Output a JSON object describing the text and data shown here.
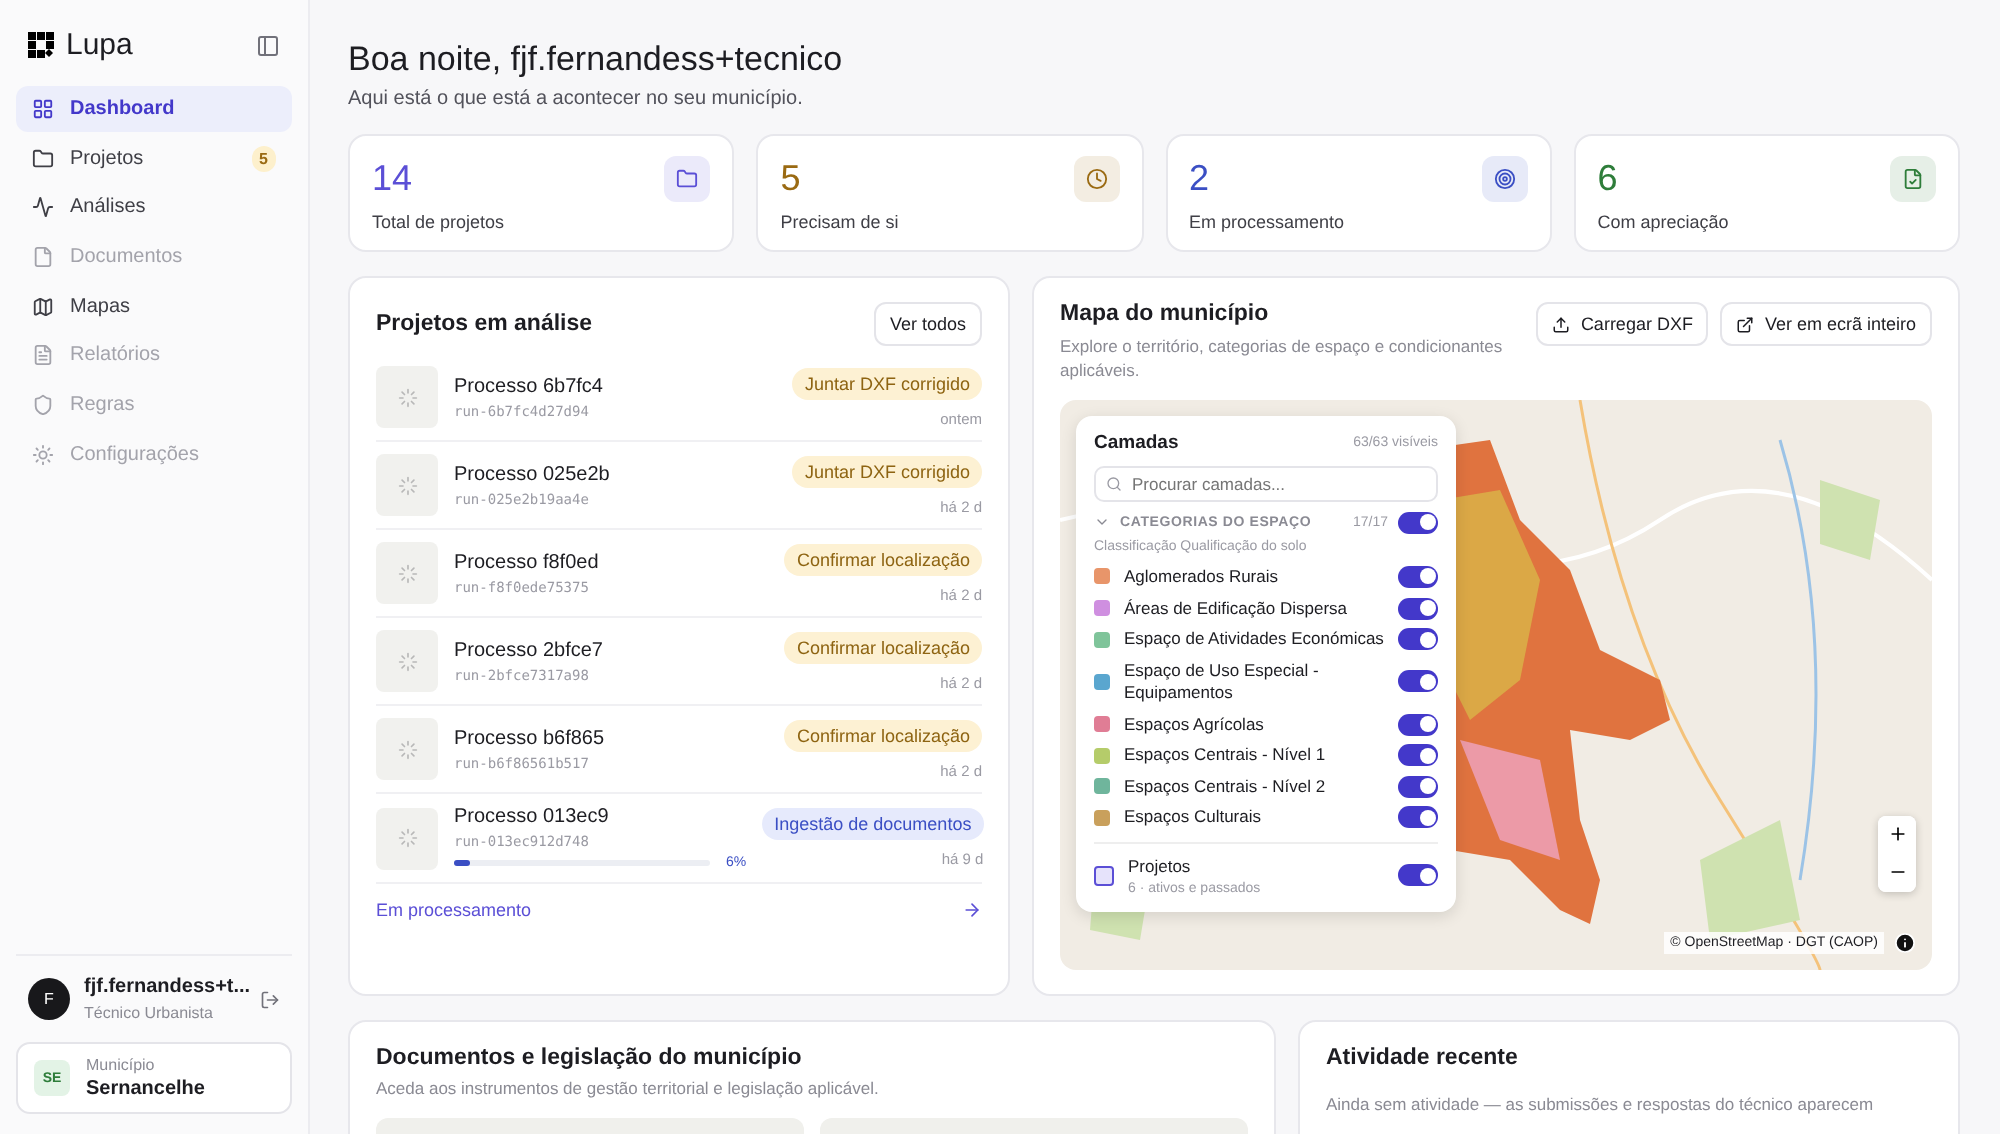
{
  "sidebar": {
    "brand": "Lupa",
    "items": [
      {
        "label": "Dashboard",
        "selected": true,
        "disabled": false
      },
      {
        "label": "Projetos",
        "selected": false,
        "disabled": false,
        "badge": "5"
      },
      {
        "label": "Análises",
        "selected": false,
        "disabled": false
      },
      {
        "label": "Documentos",
        "selected": false,
        "disabled": true
      },
      {
        "label": "Mapas",
        "selected": false,
        "disabled": false
      },
      {
        "label": "Relatórios",
        "selected": false,
        "disabled": true
      },
      {
        "label": "Regras",
        "selected": false,
        "disabled": true
      },
      {
        "label": "Configurações",
        "selected": false,
        "disabled": true
      }
    ],
    "user": {
      "initial": "F",
      "name": "fjf.fernandess+t...",
      "role": "Técnico Urbanista"
    },
    "municipality": {
      "code": "SE",
      "label": "Município",
      "name": "Sernancelhe"
    }
  },
  "header": {
    "title": "Boa noite, fjf.fernandess+tecnico",
    "subtitle": "Aqui está o que está a acontecer no seu município."
  },
  "stats": [
    {
      "value": "14",
      "label": "Total de projetos",
      "color": "#5b4fd6"
    },
    {
      "value": "5",
      "label": "Precisam de si",
      "color": "#9a6a12"
    },
    {
      "value": "2",
      "label": "Em processamento",
      "color": "#3b4fc4"
    },
    {
      "value": "6",
      "label": "Com apreciação",
      "color": "#2e7d3a"
    }
  ],
  "projects": {
    "title": "Projetos em análise",
    "button": "Ver todos",
    "rows": [
      {
        "name": "Processo 6b7fc4",
        "run": "run-6b7fc4d27d94",
        "status": "Juntar DXF corrigido",
        "kind": "warning",
        "time": "ontem"
      },
      {
        "name": "Processo 025e2b",
        "run": "run-025e2b19aa4e",
        "status": "Juntar DXF corrigido",
        "kind": "warning",
        "time": "há 2 d"
      },
      {
        "name": "Processo f8f0ed",
        "run": "run-f8f0ede75375",
        "status": "Confirmar localização",
        "kind": "warning",
        "time": "há 2 d"
      },
      {
        "name": "Processo 2bfce7",
        "run": "run-2bfce7317a98",
        "status": "Confirmar localização",
        "kind": "warning",
        "time": "há 2 d"
      },
      {
        "name": "Processo b6f865",
        "run": "run-b6f86561b517",
        "status": "Confirmar localização",
        "kind": "warning",
        "time": "há 2 d"
      },
      {
        "name": "Processo 013ec9",
        "run": "run-013ec912d748",
        "status": "Ingestão de documentos",
        "kind": "info",
        "time": "há 9 d",
        "level": 0.06,
        "percent": "6%"
      }
    ],
    "footer_link": "Em processamento"
  },
  "map": {
    "title": "Mapa do município",
    "subtitle": "Explore o território, categorias de espaço e condicionantes aplicáveis.",
    "buttons": [
      "Carregar DXF",
      "Ver em ecrã inteiro"
    ],
    "attribution": "© OpenStreetMap · DGT (CAOP)",
    "layers": {
      "title": "Camadas",
      "count": "63/63 visíveis",
      "search_placeholder": "Procurar camadas...",
      "group": {
        "title": "CATEGORIAS DO ESPAÇO",
        "count": "17/17",
        "on": true,
        "expanded": true,
        "subtitle": "Classificação Qualificação do solo"
      },
      "items": [
        {
          "label": "Aglomerados Rurais",
          "color": "#e8956a",
          "on": true
        },
        {
          "label": "Áreas de Edificação Dispersa",
          "color": "#cf8fe0",
          "on": true
        },
        {
          "label": "Espaço de Atividades Económicas",
          "color": "#7fc49a",
          "on": true
        },
        {
          "label": "Espaço de Uso Especial - Equipamentos",
          "color": "#5aa6cf",
          "on": true
        },
        {
          "label": "Espaços Agrícolas",
          "color": "#e07d95",
          "on": true
        },
        {
          "label": "Espaços Centrais - Nível 1",
          "color": "#b5cc6a",
          "on": true
        },
        {
          "label": "Espaços Centrais - Nível 2",
          "color": "#6fb59c",
          "on": true
        },
        {
          "label": "Espaços Culturais",
          "color": "#c9a05c",
          "on": true
        }
      ],
      "projects": {
        "label": "Projetos",
        "detail": "6 · ativos e passados",
        "on": true
      }
    }
  },
  "documents": {
    "title": "Documentos e legislação do município",
    "subtitle": "Aceda aos instrumentos de gestão territorial e legislação aplicável."
  },
  "activity": {
    "title": "Atividade recente",
    "text": "Ainda sem atividade — as submissões e respostas do técnico aparecem"
  }
}
